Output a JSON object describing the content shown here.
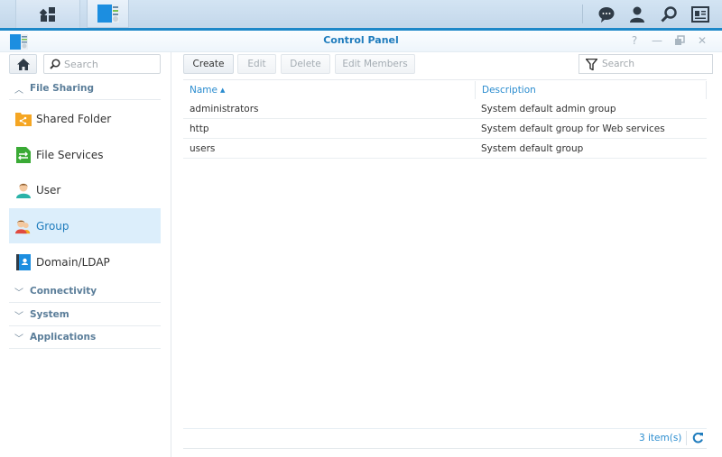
{
  "taskbar": {
    "main_menu_icon": "main-menu-icon",
    "open_app": "Control Panel",
    "right_icons": [
      "notifications-icon",
      "user-icon",
      "search-icon",
      "widgets-icon"
    ]
  },
  "window": {
    "title": "Control Panel",
    "controls": [
      "help-icon",
      "minimize-icon",
      "restore-icon",
      "close-icon"
    ]
  },
  "sidebar": {
    "search_placeholder": "Search",
    "sections": [
      {
        "label": "File Sharing",
        "expanded": true,
        "items": [
          {
            "label": "Shared Folder",
            "icon": "shared-folder-icon"
          },
          {
            "label": "File Services",
            "icon": "file-services-icon"
          },
          {
            "label": "User",
            "icon": "user-icon"
          },
          {
            "label": "Group",
            "icon": "group-icon",
            "active": true
          },
          {
            "label": "Domain/LDAP",
            "icon": "domain-ldap-icon"
          }
        ]
      },
      {
        "label": "Connectivity",
        "expanded": false
      },
      {
        "label": "System",
        "expanded": false
      },
      {
        "label": "Applications",
        "expanded": false
      }
    ]
  },
  "toolbar": {
    "create_label": "Create",
    "edit_label": "Edit",
    "delete_label": "Delete",
    "edit_members_label": "Edit Members",
    "search_placeholder": "Search"
  },
  "table": {
    "columns": [
      "Name",
      "Description"
    ],
    "sort_indicator": "▲",
    "rows": [
      {
        "name": "administrators",
        "description": "System default admin group"
      },
      {
        "name": "http",
        "description": "System default group for Web services"
      },
      {
        "name": "users",
        "description": "System default group"
      }
    ]
  },
  "footer": {
    "item_count": "3 item(s)"
  },
  "colors": {
    "accent": "#1f7cbd",
    "window_border": "#1e88c8",
    "active_item_bg": "#dceefb"
  }
}
